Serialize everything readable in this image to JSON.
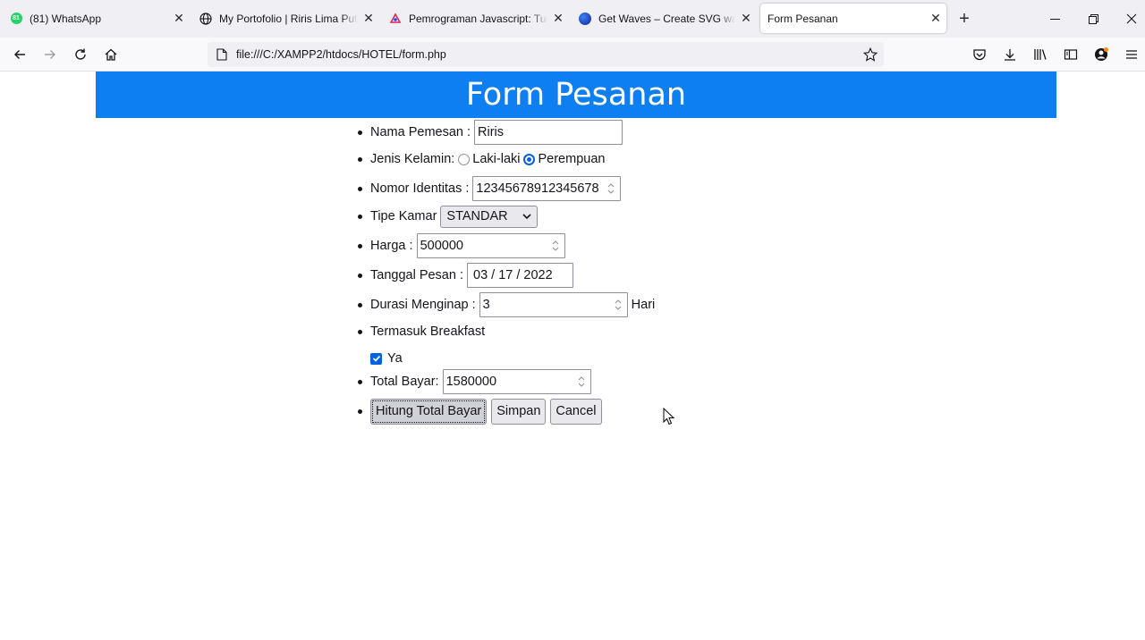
{
  "browser": {
    "tabs": [
      {
        "label": "(81) WhatsApp",
        "badge": "81",
        "icon": "whatsapp-icon",
        "active": false
      },
      {
        "label": "My Portofolio | Riris Lima Putri",
        "icon": "globe-icon",
        "active": false
      },
      {
        "label": "Pemrograman Javascript: Tugas",
        "icon": "codepolitan-icon",
        "active": false
      },
      {
        "label": "Get Waves – Create SVG waves f",
        "icon": "waves-icon",
        "active": false
      },
      {
        "label": "Form Pesanan",
        "icon": "",
        "active": true
      }
    ],
    "url": "file:///C:/XAMPP2/htdocs/HOTEL/form.php"
  },
  "page": {
    "title": "Form Pesanan",
    "accent_color": "#0d7ff0",
    "fields": {
      "nama_label": "Nama Pemesan :",
      "nama_value": "Riris",
      "kelamin_label": "Jenis Kelamin:",
      "kelamin_options": [
        "Laki-laki",
        "Perempuan"
      ],
      "kelamin_selected": "Perempuan",
      "identitas_label": "Nomor Identitas :",
      "identitas_value": "12345678912345678",
      "tipe_label": "Tipe Kamar",
      "tipe_value": "STANDAR",
      "harga_label": "Harga :",
      "harga_value": "500000",
      "tanggal_label": "Tanggal Pesan :",
      "tanggal_value": "03 / 17 / 2022",
      "durasi_label": "Durasi Menginap :",
      "durasi_value": "3",
      "durasi_unit": "Hari",
      "breakfast_label": "Termasuk Breakfast",
      "breakfast_option": "Ya",
      "breakfast_checked": true,
      "total_label": "Total Bayar:",
      "total_value": "1580000"
    },
    "buttons": {
      "hitung": "Hitung Total Bayar",
      "simpan": "Simpan",
      "cancel": "Cancel"
    }
  }
}
